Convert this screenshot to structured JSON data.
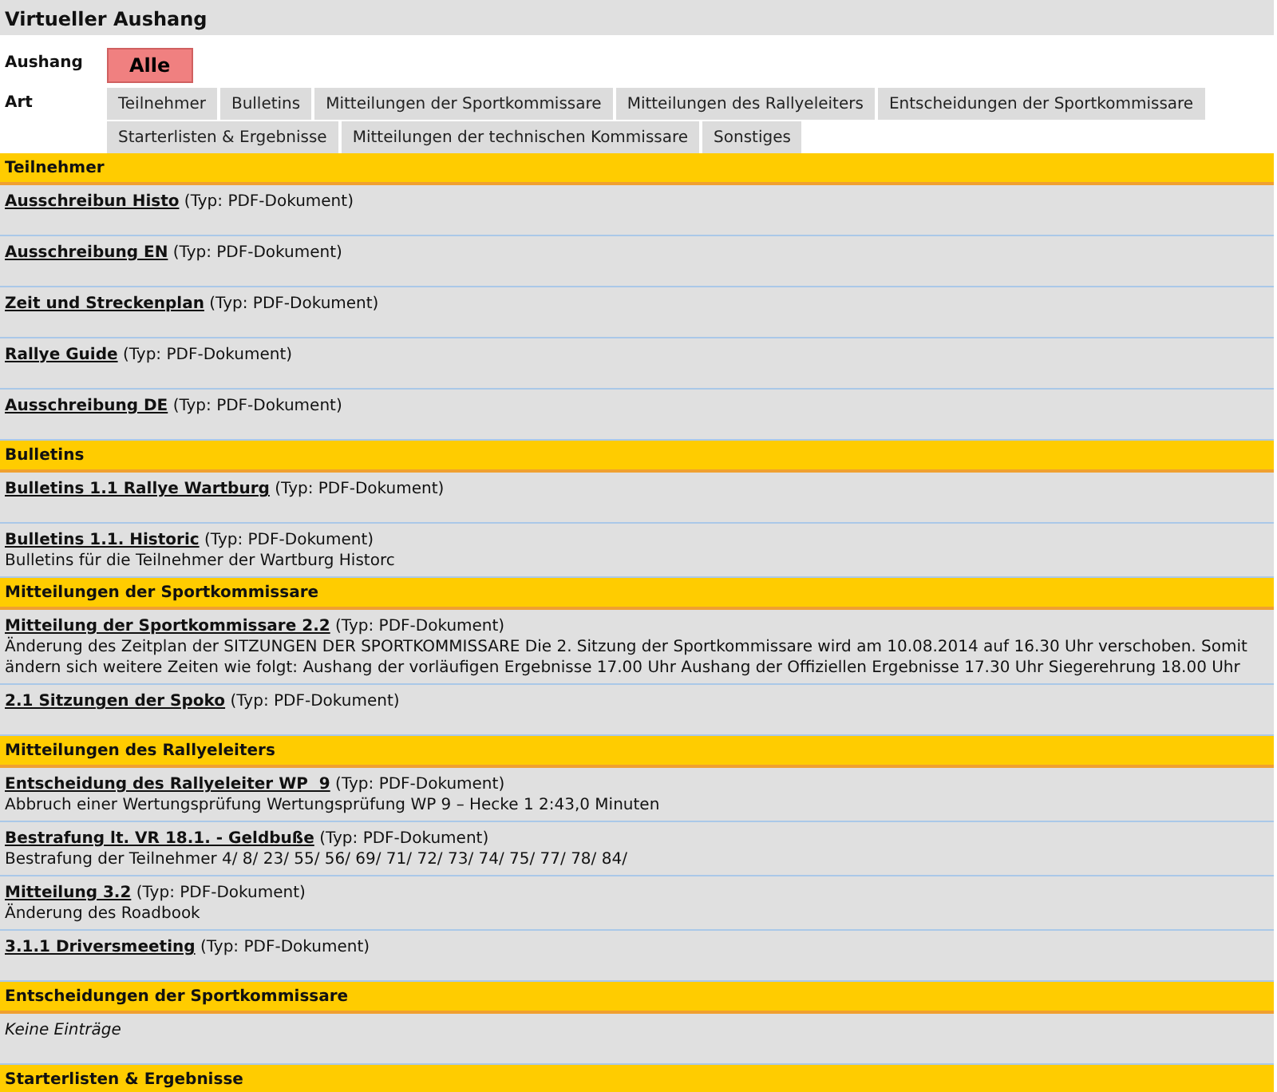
{
  "title": "Virtueller Aushang",
  "aushang": {
    "label": "Aushang",
    "tabs": [
      {
        "label": "Alle",
        "selected": true
      }
    ]
  },
  "art": {
    "label": "Art",
    "tab_rows": [
      [
        {
          "label": "Teilnehmer",
          "selected": false
        },
        {
          "label": "Bulletins",
          "selected": false
        },
        {
          "label": "Mitteilungen der Sportkommissare",
          "selected": false
        },
        {
          "label": "Mitteilungen des Rallyeleiters",
          "selected": false
        },
        {
          "label": "Entscheidungen der Sportkommissare",
          "selected": false
        }
      ],
      [
        {
          "label": "Starterlisten & Ergebnisse",
          "selected": false
        },
        {
          "label": "Mitteilungen der technischen Kommissare",
          "selected": false
        },
        {
          "label": "Sonstiges",
          "selected": false
        }
      ]
    ]
  },
  "sections": [
    {
      "title": "Teilnehmer",
      "entries": [
        {
          "link": "Ausschreibun Histo",
          "type": "(Typ: PDF-Dokument)"
        },
        {
          "link": "Ausschreibung EN",
          "type": "(Typ: PDF-Dokument)"
        },
        {
          "link": "Zeit und Streckenplan",
          "type": "(Typ: PDF-Dokument)"
        },
        {
          "link": "Rallye Guide",
          "type": "(Typ: PDF-Dokument)"
        },
        {
          "link": "Ausschreibung DE",
          "type": "(Typ: PDF-Dokument)"
        }
      ]
    },
    {
      "title": "Bulletins",
      "entries": [
        {
          "link": "Bulletins 1.1 Rallye Wartburg",
          "type": "(Typ: PDF-Dokument)"
        },
        {
          "link": "Bulletins 1.1. Historic",
          "type": "(Typ: PDF-Dokument)",
          "description": "Bulletins für die Teilnehmer der Wartburg Historc"
        }
      ]
    },
    {
      "title": "Mitteilungen der Sportkommissare",
      "entries": [
        {
          "link": "Mitteilung der Sportkommissare 2.2",
          "type": "(Typ: PDF-Dokument)",
          "description": "Änderung des Zeitplan der SITZUNGEN DER SPORTKOMMISSARE Die 2. Sitzung der Sportkommissare wird am 10.08.2014 auf 16.30 Uhr verschoben. Somit ändern sich weitere Zeiten wie folgt: Aushang der vorläufigen Ergebnisse 17.00 Uhr Aushang der Offiziellen Ergebnisse 17.30 Uhr Siegerehrung 18.00 Uhr"
        },
        {
          "link": "2.1 Sitzungen der Spoko",
          "type": "(Typ: PDF-Dokument)"
        }
      ]
    },
    {
      "title": "Mitteilungen des Rallyeleiters",
      "entries": [
        {
          "link": "Entscheidung des Rallyeleiter WP  9",
          "type": "(Typ: PDF-Dokument)",
          "description": "Abbruch einer Wertungsprüfung Wertungsprüfung WP 9 – Hecke 1 2:43,0 Minuten"
        },
        {
          "link": "Bestrafung lt. VR 18.1. - Geldbuße",
          "type": "(Typ: PDF-Dokument)",
          "description": "Bestrafung der Teilnehmer 4/ 8/ 23/ 55/ 56/ 69/ 71/ 72/ 73/ 74/ 75/ 77/ 78/ 84/"
        },
        {
          "link": "Mitteilung 3.2",
          "type": "(Typ: PDF-Dokument)",
          "description": "Änderung des Roadbook"
        },
        {
          "link": "3.1.1 Driversmeeting",
          "type": "(Typ: PDF-Dokument)"
        }
      ]
    },
    {
      "title": "Entscheidungen der Sportkommissare",
      "empty_text": "Keine Einträge"
    },
    {
      "title": "Starterlisten & Ergebnisse"
    }
  ]
}
